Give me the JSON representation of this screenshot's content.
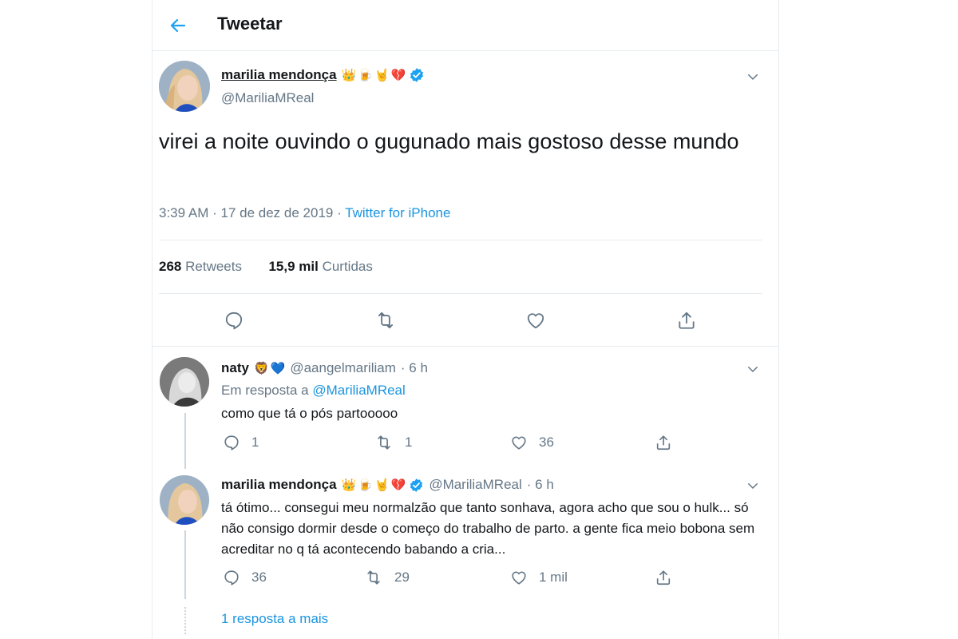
{
  "header": {
    "title": "Tweetar"
  },
  "main_tweet": {
    "name": "marilia mendonça",
    "name_emojis": [
      "👑",
      "🍺",
      "🤘",
      "💔"
    ],
    "handle": "@MariliaMReal",
    "text": "virei a noite ouvindo o gugunado mais gostoso desse mundo",
    "time": "3:39 AM",
    "date": "17 de dez de 2019",
    "source": "Twitter for iPhone",
    "retweets_value": "268",
    "retweets_label": "Retweets",
    "likes_value": "15,9 mil",
    "likes_label": "Curtidas"
  },
  "replies": [
    {
      "name": "naty",
      "name_emojis": [
        "🦁",
        "💙"
      ],
      "handle": "@aangelmariliam",
      "time": "6 h",
      "reply_to_prefix": "Em resposta a",
      "reply_to_handle": "@MariliaMReal",
      "text": "como que tá o pós partooooo",
      "counts": {
        "reply": "1",
        "retweet": "1",
        "like": "36"
      }
    },
    {
      "name": "marilia mendonça",
      "name_emojis": [
        "👑",
        "🍺",
        "🤘",
        "💔"
      ],
      "handle": "@MariliaMReal",
      "time": "6 h",
      "text": "tá ótimo... consegui meu normalzão que tanto sonhava, agora acho que sou o hulk... só não consigo dormir desde o começo do trabalho de parto. a gente fica meio bobona sem acreditar no q tá acontecendo babando a cria...",
      "counts": {
        "reply": "36",
        "retweet": "29",
        "like": "1 mil"
      }
    }
  ],
  "more_replies": "1 resposta a mais",
  "colors": {
    "accent": "#1da1f2",
    "link": "#1b95e0",
    "muted": "#657786",
    "border": "#e6ecf0"
  },
  "icons": [
    "back-arrow-icon",
    "chevron-down-icon",
    "verified-badge-icon",
    "reply-icon",
    "retweet-icon",
    "like-icon",
    "share-icon"
  ]
}
